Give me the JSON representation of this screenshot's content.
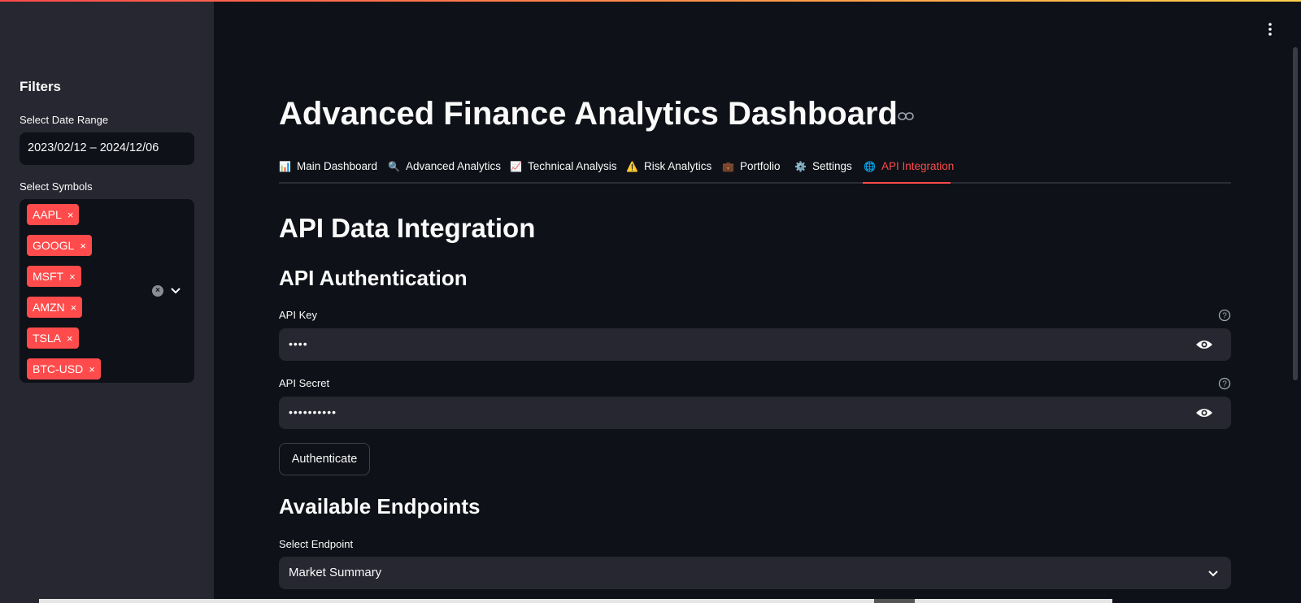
{
  "sidebar": {
    "title": "Filters",
    "date_label": "Select Date Range",
    "date_value": "2023/02/12 – 2024/12/06",
    "symbols_label": "Select Symbols",
    "symbols": [
      "AAPL",
      "GOOGL",
      "MSFT",
      "AMZN",
      "TSLA",
      "BTC-USD"
    ],
    "remove_glyph": "×"
  },
  "header": {
    "title": "Advanced Finance Analytics Dashboard"
  },
  "tabs": [
    {
      "icon": "📊",
      "label": "Main Dashboard"
    },
    {
      "icon": "🔍",
      "label": "Advanced Analytics"
    },
    {
      "icon": "📈",
      "label": "Technical Analysis"
    },
    {
      "icon": "⚠️",
      "label": "Risk Analytics"
    },
    {
      "icon": "💼",
      "label": "Portfolio"
    },
    {
      "icon": "⚙️",
      "label": "Settings"
    },
    {
      "icon": "🌐",
      "label": "API Integration",
      "active": true
    }
  ],
  "content": {
    "heading": "API Data Integration",
    "auth_heading": "API Authentication",
    "api_key_label": "API Key",
    "api_key_value": "••••",
    "api_secret_label": "API Secret",
    "api_secret_value": "••••••••••",
    "auth_button": "Authenticate",
    "endpoints_heading": "Available Endpoints",
    "endpoint_label": "Select Endpoint",
    "endpoint_value": "Market Summary"
  },
  "colors": {
    "accent": "#ff4b4b",
    "background": "#0e1117",
    "sidebar": "#262730"
  }
}
